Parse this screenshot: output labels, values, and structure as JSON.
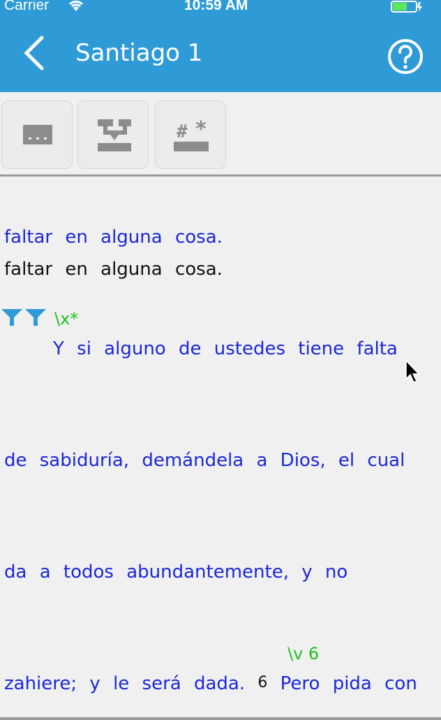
{
  "status_bar": {
    "carrier": "Carrier",
    "time": "10:59 AM"
  },
  "nav": {
    "title": "Santiago 1",
    "back_icon": "chevron-left-icon",
    "help_icon": "question-circle-icon"
  },
  "toolbar": {
    "buttons": [
      {
        "icon": "ellipsis-block-icon"
      },
      {
        "icon": "structure-merge-icon"
      },
      {
        "icon": "marker-hash-icon"
      }
    ]
  },
  "text": {
    "line1": "faltar en alguna cosa.",
    "line2": "faltar en alguna cosa.",
    "marker_x_end": "\\x*",
    "line3": "Y   si alguno de ustedes tiene falta",
    "line4": "de sabiduría, demándela a Dios, el cual",
    "line5": "da a todos abundantemente, y no",
    "marker_v6": "\\v 6",
    "verse_number": "6",
    "line6a": "zahiere; y le será dada.",
    "line6b": "Pero pida con"
  },
  "colors": {
    "header_blue": "#2e9bd6",
    "text_blue": "#1c28d6",
    "marker_green": "#1dc21d"
  }
}
